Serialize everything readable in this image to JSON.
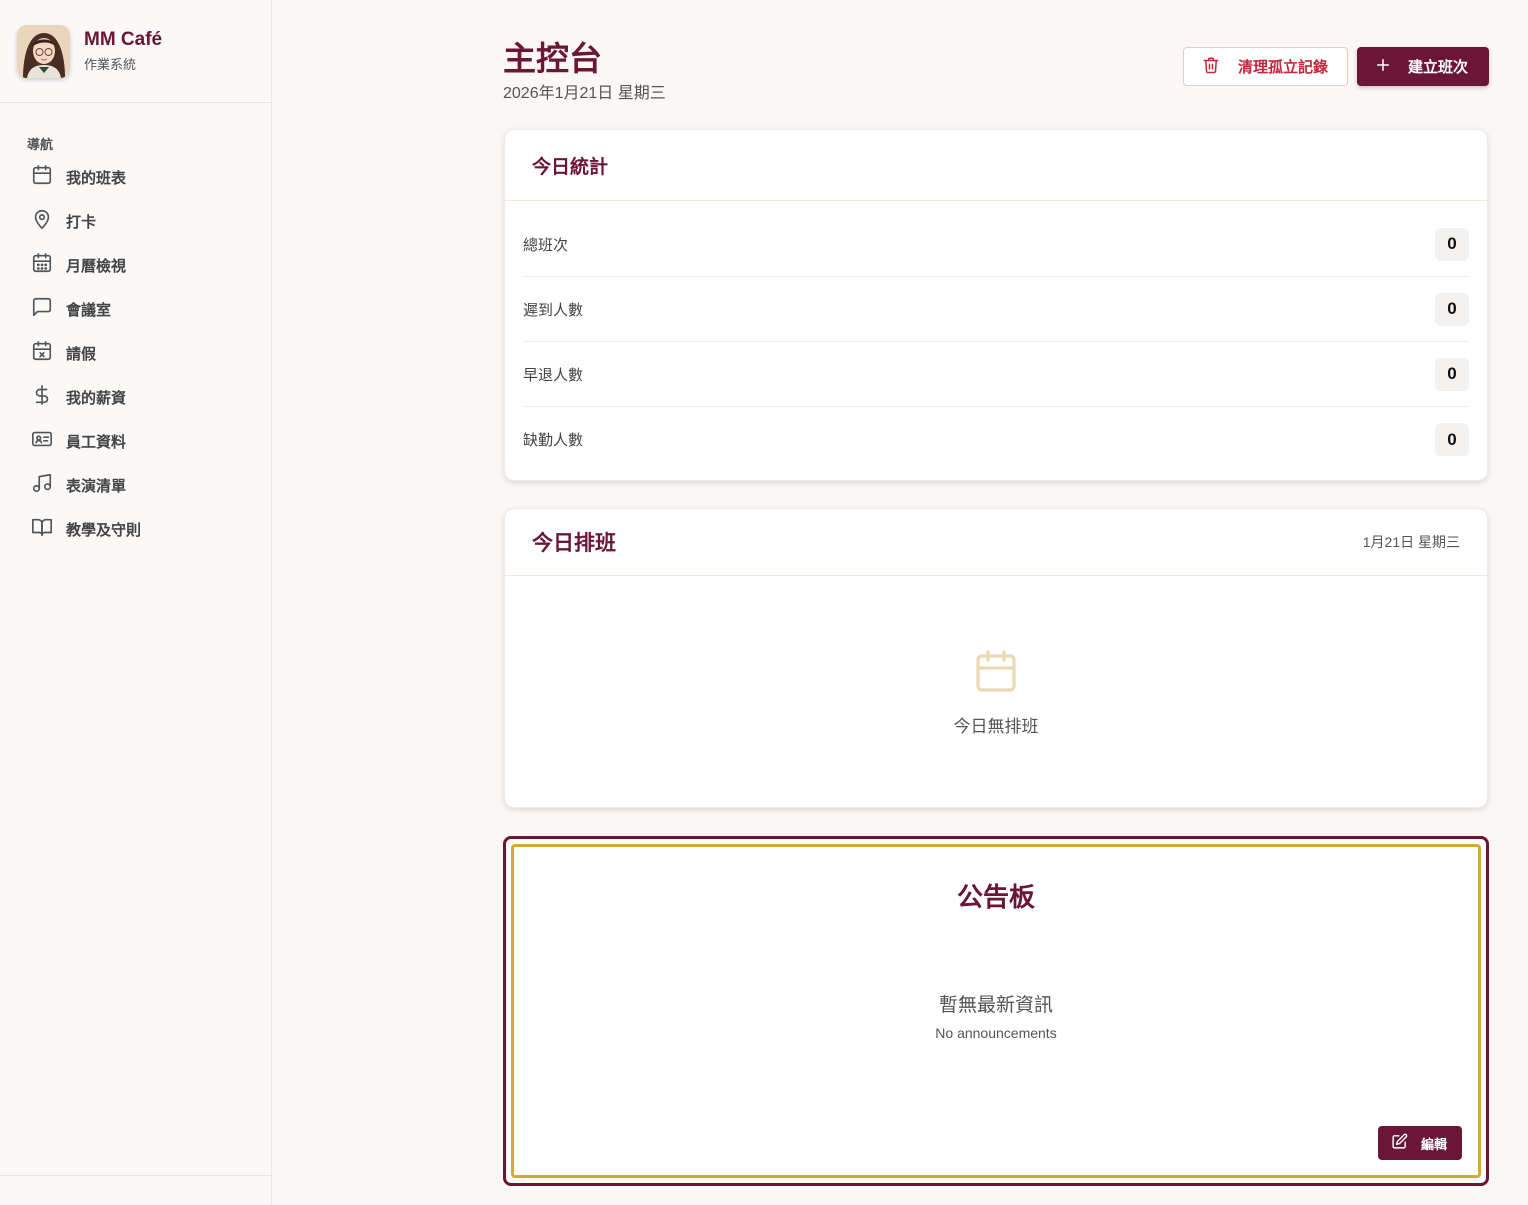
{
  "brand": {
    "name": "MM Café",
    "subtitle": "作業系統"
  },
  "nav": {
    "heading": "導航",
    "items": [
      {
        "label": "我的班表",
        "icon": "calendar-icon"
      },
      {
        "label": "打卡",
        "icon": "map-pin-icon"
      },
      {
        "label": "月曆檢視",
        "icon": "calendar-grid-icon"
      },
      {
        "label": "會議室",
        "icon": "chat-bubble-icon"
      },
      {
        "label": "請假",
        "icon": "calendar-x-icon"
      },
      {
        "label": "我的薪資",
        "icon": "dollar-icon"
      },
      {
        "label": "員工資料",
        "icon": "id-card-icon"
      },
      {
        "label": "表演清單",
        "icon": "music-note-icon"
      },
      {
        "label": "教學及守則",
        "icon": "book-open-icon"
      }
    ]
  },
  "header": {
    "title": "主控台",
    "date": "2026年1月21日 星期三",
    "clean_button": "清理孤立記錄",
    "create_button": "建立班次"
  },
  "stats": {
    "title": "今日統計",
    "rows": [
      {
        "label": "總班次",
        "value": "0"
      },
      {
        "label": "遲到人數",
        "value": "0"
      },
      {
        "label": "早退人數",
        "value": "0"
      },
      {
        "label": "缺勤人數",
        "value": "0"
      }
    ]
  },
  "schedule": {
    "title": "今日排班",
    "date": "1月21日 星期三",
    "empty_text": "今日無排班"
  },
  "board": {
    "title": "公告板",
    "empty_zh": "暫無最新資訊",
    "empty_en": "No announcements",
    "edit_button": "編輯"
  },
  "colors": {
    "brand": "#6b1537",
    "gold": "#d4a836",
    "danger": "#c0283e"
  }
}
